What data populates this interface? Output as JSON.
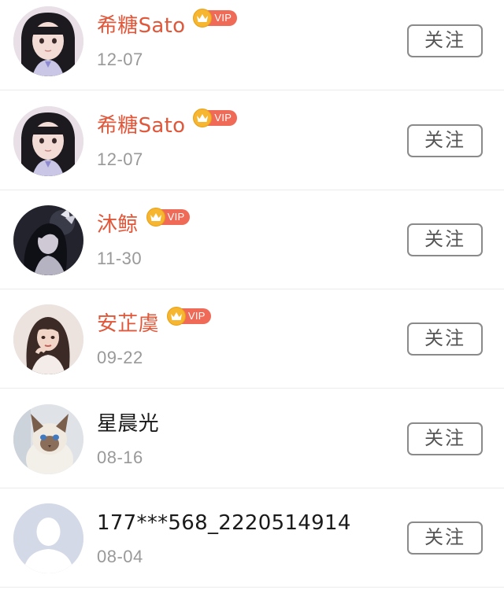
{
  "follow_list": [
    {
      "name": "希糖Sato",
      "vip": true,
      "vip_label": "VIP",
      "date": "12-07",
      "button": "关注",
      "avatar": "girl-illustration"
    },
    {
      "name": "希糖Sato",
      "vip": true,
      "vip_label": "VIP",
      "date": "12-07",
      "button": "关注",
      "avatar": "girl-illustration"
    },
    {
      "name": "沐鲸",
      "vip": true,
      "vip_label": "VIP",
      "date": "11-30",
      "button": "关注",
      "avatar": "dark-anime-character"
    },
    {
      "name": "安芷虞",
      "vip": true,
      "vip_label": "VIP",
      "date": "09-22",
      "button": "关注",
      "avatar": "woman-illustration"
    },
    {
      "name": "星晨光",
      "vip": false,
      "date": "08-16",
      "button": "关注",
      "avatar": "cat-photo"
    },
    {
      "name": "177***568_2220514914",
      "vip": false,
      "date": "08-04",
      "button": "关注",
      "avatar": "default-person"
    }
  ],
  "colors": {
    "vip_name": "#e0573a",
    "normal_name": "#1a1a1a",
    "date": "#999999",
    "button_border": "#8a8a8a",
    "vip_badge": "#ef6b58",
    "vip_crown": "#f6b630"
  }
}
